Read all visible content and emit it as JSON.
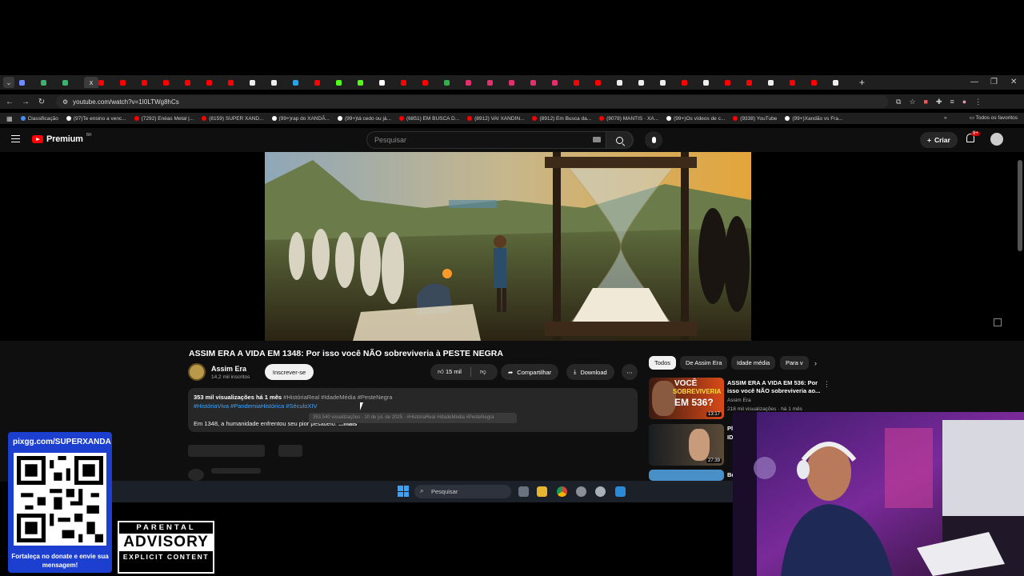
{
  "browser": {
    "tab_glyph": "x",
    "new_tab": "+",
    "url": "youtube.com/watch?v=1I0LTWg8hCs",
    "bookmarks": [
      {
        "label": "Classificação",
        "color": "#4c8bf5"
      },
      {
        "label": "(97)Te ensino a venc...",
        "color": "#ffffff"
      },
      {
        "label": "(7292) Enéas Metal |...",
        "color": "#ff0000"
      },
      {
        "label": "(8159) SUPER XAND...",
        "color": "#ff0000"
      },
      {
        "label": "(99+)rap do XANDÃ...",
        "color": "#ffffff"
      },
      {
        "label": "(99+)tá cedo ou já...",
        "color": "#ffffff"
      },
      {
        "label": "(6851) EM BUSCA D...",
        "color": "#ff0000"
      },
      {
        "label": "(8912) VAI XANDIN...",
        "color": "#ff0000"
      },
      {
        "label": "(8912) Em Busca da...",
        "color": "#ff0000"
      },
      {
        "label": "(9078) MANTIS · XA...",
        "color": "#ff0000"
      },
      {
        "label": "(99+)Os vídeos de c...",
        "color": "#ffffff"
      },
      {
        "label": "(9338) YouTube",
        "color": "#ff0000"
      },
      {
        "label": "(99+)Xandão vs Fra...",
        "color": "#ffffff"
      }
    ],
    "bookmarks_more": "»",
    "all_favorites": "Todos os favoritos"
  },
  "yt": {
    "logo_text": "Premium",
    "logo_region": "BR",
    "search_placeholder": "Pesquisar",
    "create_label": "Criar",
    "notif_badge": "9+",
    "video_title": "ASSIM ERA A VIDA EM 1348: Por isso você NÃO sobreviveria à PESTE NEGRA",
    "channel_name": "Assim Era",
    "subscribers": "14,2 mil inscritos",
    "subscribe_label": "Inscrever-se",
    "likes": "15 mil",
    "share_label": "Compartilhar",
    "download_label": "Download",
    "views_line": "353 mil visualizações  há 1 mês",
    "views_tags": "#HistóriaReal #IdadeMédia #PesteNegra",
    "hashtags": "#HistóriaViva #PandemiaHistórica #SéculoXIV",
    "description": "Em 1348, a humanidade enfrentou seu pior pesadelo.",
    "more_label": "...mais",
    "tooltip": "353.540 visualizações · 10 de jul. de 2025 · #HistóriaReal #IdadeMédia #PesteNegra",
    "chips": [
      "Todos",
      "De Assim Era",
      "Idade média",
      "Para v"
    ],
    "rec1": {
      "title": "ASSIM ERA A VIDA EM 536: Por isso você NÃO sobreviveria ao...",
      "channel": "Assim Era",
      "meta": "218 mil visualizações · há 1 mês",
      "duration": "13:17",
      "thumb_text1": "VOCÊ",
      "thumb_text2": "SOBREVIVERIA",
      "thumb_text3": "EM 536?"
    },
    "rec2": {
      "duration": "27:39",
      "title_partial": "Pl",
      "title_partial2": "ID"
    },
    "rec3": {
      "title_partial": "Be"
    }
  },
  "taskbar": {
    "search_placeholder": "Pesquisar"
  },
  "overlay": {
    "qr_url": "pixgg.com/SUPERXANDA",
    "qr_caption": "Fortaleça no donate e envie sua mensagem!",
    "advisory_line1": "PARENTAL",
    "advisory_line2": "ADVISORY",
    "advisory_line3": "EXPLICIT CONTENT"
  }
}
